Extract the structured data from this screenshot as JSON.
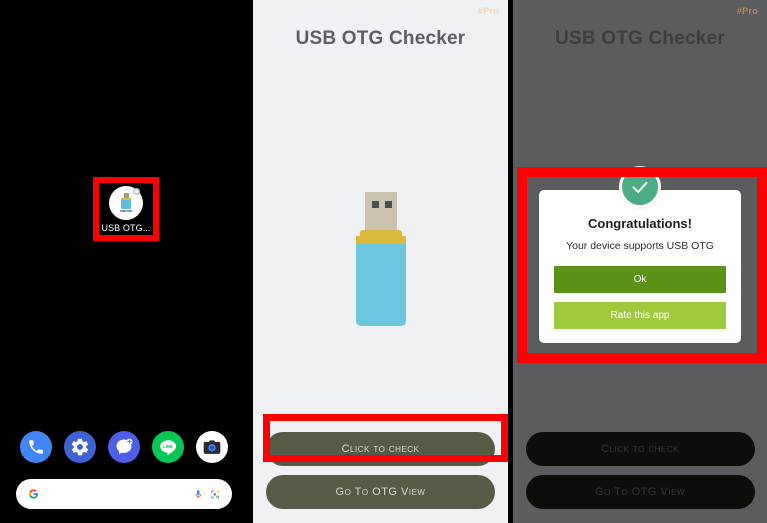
{
  "home_screen": {
    "app_icon": {
      "label": "USB OTG...",
      "icon_text": "USB OTG"
    },
    "dock": {
      "items": [
        {
          "name": "phone",
          "label": "Phone"
        },
        {
          "name": "settings",
          "label": "Settings"
        },
        {
          "name": "messages",
          "label": "Messages"
        },
        {
          "name": "line",
          "label": "LINE"
        },
        {
          "name": "camera",
          "label": "Camera"
        }
      ]
    },
    "search_bar": {
      "placeholder": "",
      "value": ""
    }
  },
  "main_screen": {
    "title": "USB OTG Checker",
    "pro_badge": "#Pro",
    "buttons": {
      "check": "Click to check",
      "otg_view": "Go To OTG View"
    }
  },
  "dialog_screen": {
    "title": "USB OTG Checker",
    "pro_badge": "#Pro",
    "buttons": {
      "check": "Click to check",
      "otg_view": "Go To OTG View"
    },
    "dialog": {
      "heading": "Congratulations!",
      "message": "Your device supports USB OTG",
      "ok_button": "Ok",
      "rate_button": "Rate this app"
    }
  },
  "colors": {
    "highlight": "#ff0000",
    "button_olive": "#565b45",
    "dialog_ok_green": "#5c9117",
    "dialog_rate_green": "#a0ca3e",
    "check_circle_green": "#4aab84",
    "usb_body_blue": "#6cc6dd",
    "usb_band_yellow": "#d9b93c",
    "title_gray": "#5a5f66"
  }
}
